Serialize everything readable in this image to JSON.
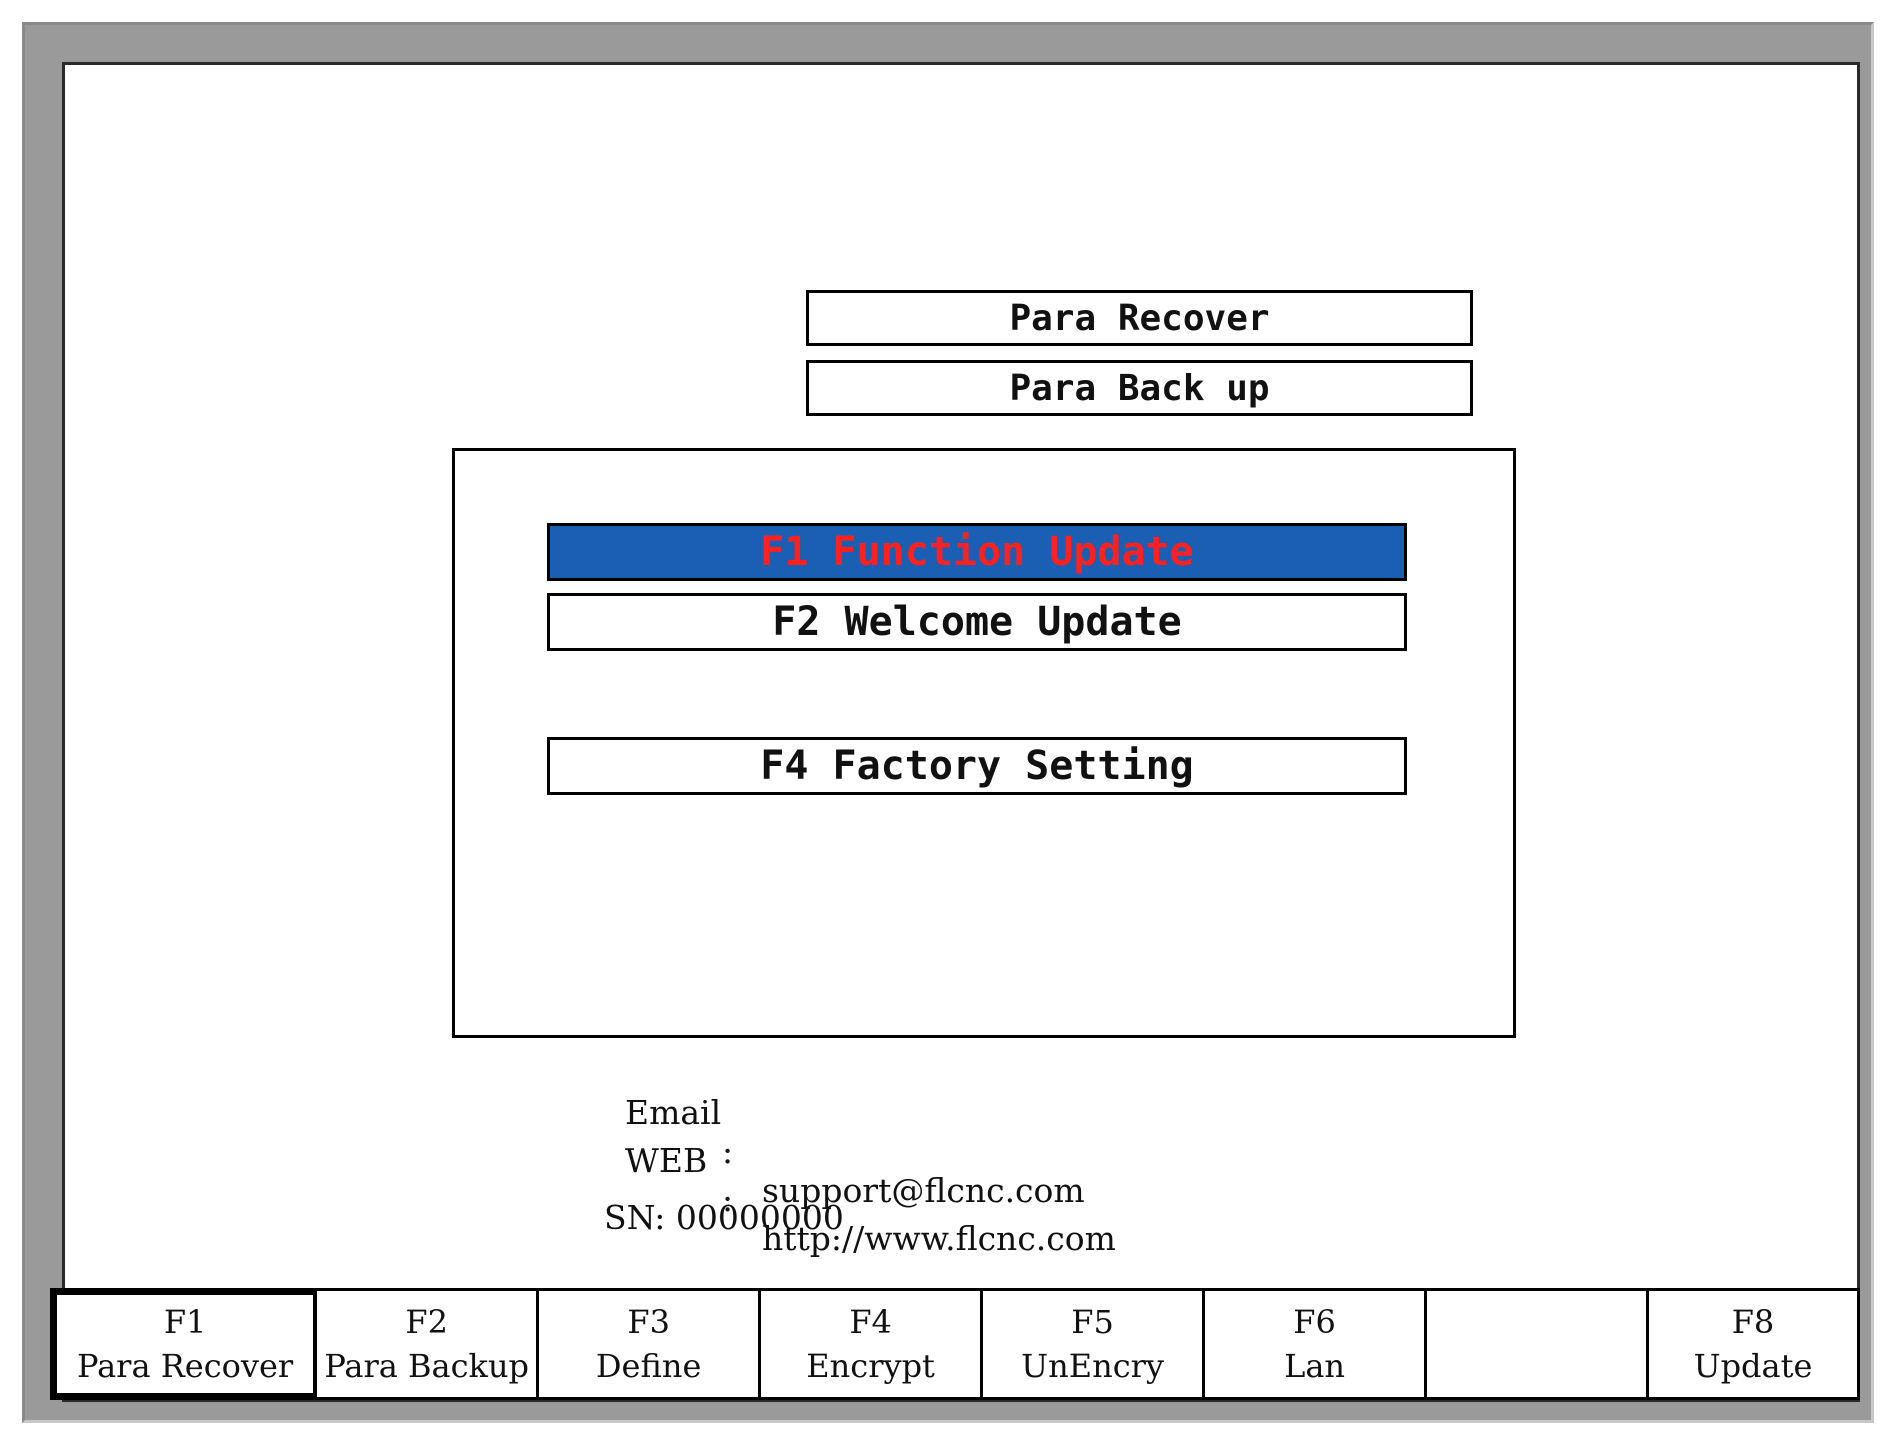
{
  "background_menu": {
    "items": [
      "Para Recover",
      "Para Back up"
    ]
  },
  "dialog": {
    "options": [
      "F1 Function Update",
      "F2 Welcome Update",
      "F4 Factory Setting"
    ],
    "selected_index": 0,
    "highlight_color": "#1a5fb4",
    "highlight_text_color": "#ff2020"
  },
  "contact": {
    "email_label": "Email",
    "email_sep": ":",
    "email_value": "support@flcnc.com",
    "web_label": "WEB",
    "web_sep": ":",
    "web_value": "http://www.flcnc.com",
    "sn_text": "SN: 00000000"
  },
  "function_keys": [
    {
      "key": "F1",
      "label": "Para Recover"
    },
    {
      "key": "F2",
      "label": "Para Backup"
    },
    {
      "key": "F3",
      "label": "Define"
    },
    {
      "key": "F4",
      "label": "Encrypt"
    },
    {
      "key": "F5",
      "label": "UnEncry"
    },
    {
      "key": "F6",
      "label": "Lan"
    },
    {
      "key": "",
      "label": ""
    },
    {
      "key": "F8",
      "label": "Update"
    }
  ]
}
